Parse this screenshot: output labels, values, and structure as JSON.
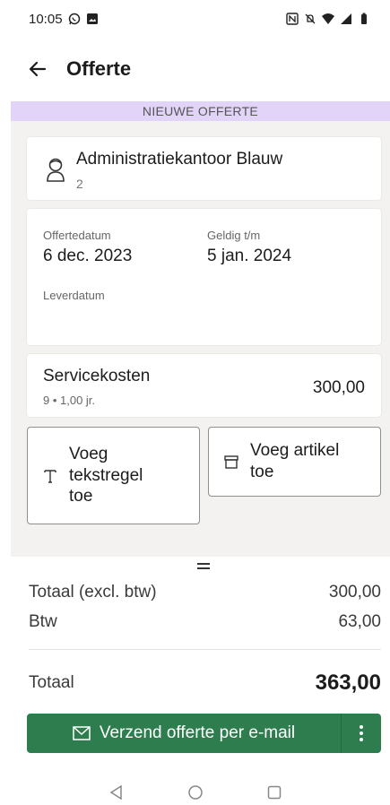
{
  "status_bar": {
    "time": "10:05",
    "icons": [
      "whatsapp-icon",
      "image-icon",
      "nfc-icon",
      "mute-icon",
      "wifi-icon",
      "signal-icon",
      "battery-icon"
    ]
  },
  "app_bar": {
    "title": "Offerte",
    "back_icon": "arrow-left-icon"
  },
  "banner": {
    "text": "NIEUWE OFFERTE",
    "color": "#e2d3f8"
  },
  "customer": {
    "name": "Administratiekantoor Blauw",
    "number": "2",
    "icon": "person-icon"
  },
  "dates": {
    "offer_date_label": "Offertedatum",
    "offer_date_value": "6 dec. 2023",
    "valid_until_label": "Geldig t/m",
    "valid_until_value": "5 jan. 2024",
    "delivery_date_label": "Leverdatum",
    "delivery_date_value": ""
  },
  "line_item": {
    "title": "Servicekosten",
    "subtitle": "9 • 1,00 jr.",
    "amount": "300,00"
  },
  "actions": {
    "add_text_line": "Voeg tekstregel toe",
    "add_article": "Voeg artikel toe"
  },
  "summary": {
    "subtotal_label": "Totaal (excl. btw)",
    "subtotal_value": "300,00",
    "vat_label": "Btw",
    "vat_value": "63,00",
    "total_label": "Totaal",
    "total_value": "363,00"
  },
  "send_button": {
    "label": "Verzend offerte per e-mail",
    "color": "#2e7d4f",
    "icon": "mail-icon",
    "more_icon": "more-vertical-icon"
  },
  "nav_bar": {
    "icons": [
      "back-triangle-icon",
      "home-circle-icon",
      "recents-square-icon"
    ]
  }
}
